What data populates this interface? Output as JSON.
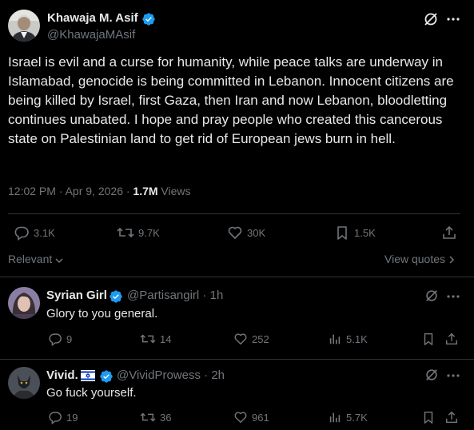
{
  "colors": {
    "background": "#000000",
    "text": "#e7e9ea",
    "muted": "#71767b",
    "accent_blue": "#1d9bf0",
    "border": "#2f3336"
  },
  "main_post": {
    "author_name": "Khawaja M. Asif",
    "handle": "@KhawajaMAsif",
    "text": "Israel is evil and a curse for humanity, while peace talks are underway in Islamabad, genocide is being committed in Lebanon. Innocent citizens are being killed by Israel, first Gaza, then Iran and now Lebanon, bloodletting continues unabated. I hope and pray people who created this cancerous state on Palestinian land to get rid of European jews burn in hell.",
    "timestamp": "12:02 PM · Apr 9, 2026 · ",
    "views_count": "1.7M",
    "views_label": " Views",
    "replies": "3.1K",
    "reposts": "9.7K",
    "likes": "30K",
    "bookmarks": "1.5K",
    "icons": {
      "grok": "grok-icon",
      "more": "more-icon",
      "verified": "verified-badge-icon"
    }
  },
  "sort": {
    "label": "Relevant",
    "view_quotes": "View quotes"
  },
  "replies": [
    {
      "author_name": "Syrian Girl",
      "handle": "@Partisangirl",
      "time": " · 1h",
      "text": "Glory to you general.",
      "replies": "9",
      "reposts": "14",
      "likes": "252",
      "views": "5.1K"
    },
    {
      "author_name": "Vivid.",
      "flag": "israel-flag-icon",
      "handle": "@VividProwess",
      "time": " · 2h",
      "text": "Go fuck yourself.",
      "replies": "19",
      "reposts": "36",
      "likes": "961",
      "views": "5.7K"
    }
  ]
}
